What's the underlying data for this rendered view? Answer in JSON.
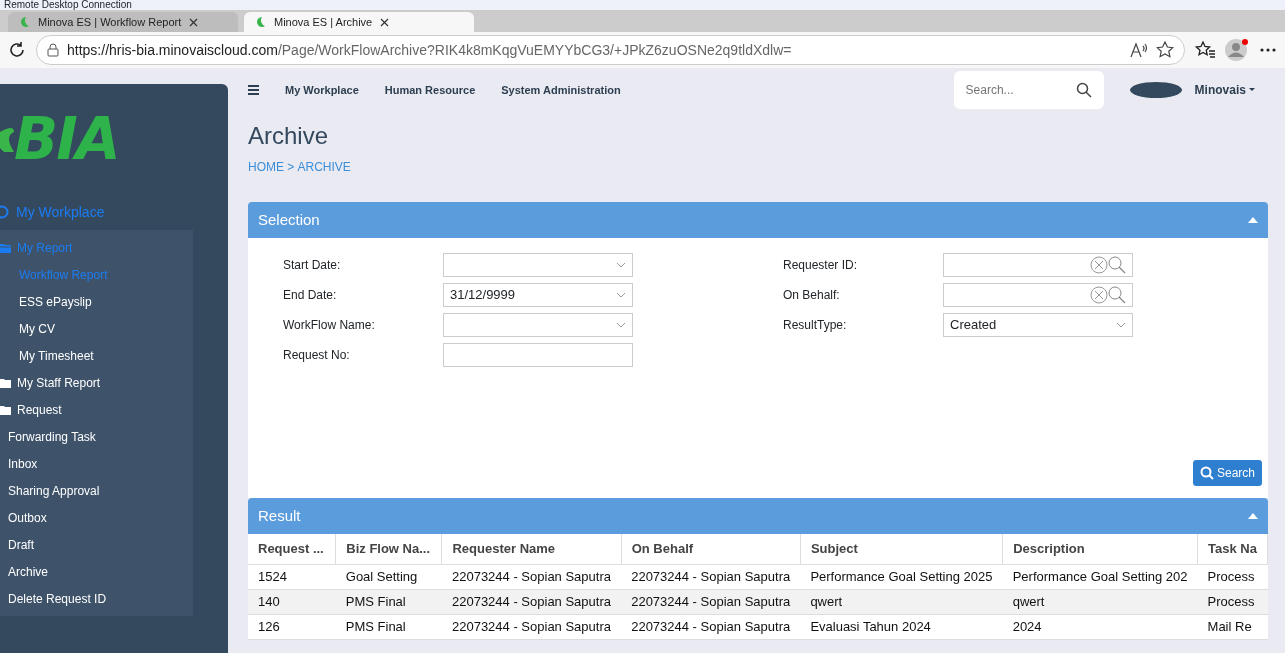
{
  "window": {
    "title": "Remote Desktop Connection"
  },
  "browser": {
    "tabs": [
      {
        "label": "Minova ES | Workflow Report",
        "selected": false
      },
      {
        "label": "Minova ES | Archive",
        "selected": true
      }
    ],
    "url_host": "https://hris-bia.minovaiscloud.com",
    "url_path": "/Page/WorkFlowArchive?RIK4k8mKqgVuEMYYbCG3/+JPkZ6zuOSNe2q9tldXdlw="
  },
  "topnav": {
    "menu": [
      "My Workplace",
      "Human Resource",
      "System Administration"
    ],
    "search": {
      "placeholder": "Search..."
    },
    "user": "Minovais"
  },
  "sidebar": {
    "logo": "BIA",
    "section": {
      "label": "My Workplace",
      "selected": true
    },
    "items": [
      {
        "kind": "folder",
        "label": "My Report",
        "selected": true,
        "expanded": true,
        "children": [
          {
            "kind": "link",
            "label": "Workflow Report",
            "selected": true
          },
          {
            "kind": "link",
            "label": "ESS ePayslip",
            "selected": false
          },
          {
            "kind": "link",
            "label": "My CV",
            "selected": false
          },
          {
            "kind": "link",
            "label": "My Timesheet",
            "selected": false
          }
        ]
      },
      {
        "kind": "folder",
        "label": "My Staff Report",
        "selected": false,
        "expanded": false
      },
      {
        "kind": "folder",
        "label": "Request",
        "selected": false,
        "expanded": false
      },
      {
        "kind": "link",
        "label": "Forwarding Task",
        "selected": false
      },
      {
        "kind": "link",
        "label": "Inbox",
        "selected": false
      },
      {
        "kind": "link",
        "label": "Sharing Approval",
        "selected": false
      },
      {
        "kind": "link",
        "label": "Outbox",
        "selected": false
      },
      {
        "kind": "link",
        "label": "Draft",
        "selected": false
      },
      {
        "kind": "link",
        "label": "Archive",
        "selected": false
      },
      {
        "kind": "link",
        "label": "Delete Request ID",
        "selected": false
      }
    ]
  },
  "page": {
    "title": "Archive",
    "breadcrumb": [
      "HOME",
      ">",
      "ARCHIVE"
    ]
  },
  "selection": {
    "title": "Selection",
    "expanded": true,
    "left_fields": [
      {
        "label": "Start Date:",
        "kind": "select"
      },
      {
        "label": "End Date:",
        "kind": "select",
        "value": "31/12/9999"
      },
      {
        "label": "WorkFlow Name:",
        "kind": "select"
      },
      {
        "label": "Request No:",
        "kind": "text"
      }
    ],
    "right_fields": [
      {
        "label": "Requester ID:",
        "kind": "lookup"
      },
      {
        "label": "On Behalf:",
        "kind": "lookup"
      },
      {
        "label": "ResultType:",
        "kind": "select",
        "value": "Created"
      }
    ],
    "search_button": "Search"
  },
  "result": {
    "title": "Result",
    "expanded": true,
    "columns": [
      "Request ...",
      "Biz Flow Na...",
      "Requester Name",
      "On Behalf",
      "Subject",
      "Description",
      "Task Na"
    ],
    "rows": [
      [
        "1524",
        "Goal Setting",
        "22073244 - Sopian Saputra",
        "22073244 - Sopian Saputra",
        "Performance Goal Setting 2025",
        "Performance Goal Setting 202",
        "Process"
      ],
      [
        "140",
        "PMS Final",
        "22073244 - Sopian Saputra",
        "22073244 - Sopian Saputra",
        "qwert",
        "qwert",
        "Process"
      ],
      [
        "126",
        "PMS Final",
        "22073244 - Sopian Saputra",
        "22073244 - Sopian Saputra",
        "Evaluasi Tahun 2024",
        "2024",
        "Mail Re"
      ]
    ]
  }
}
